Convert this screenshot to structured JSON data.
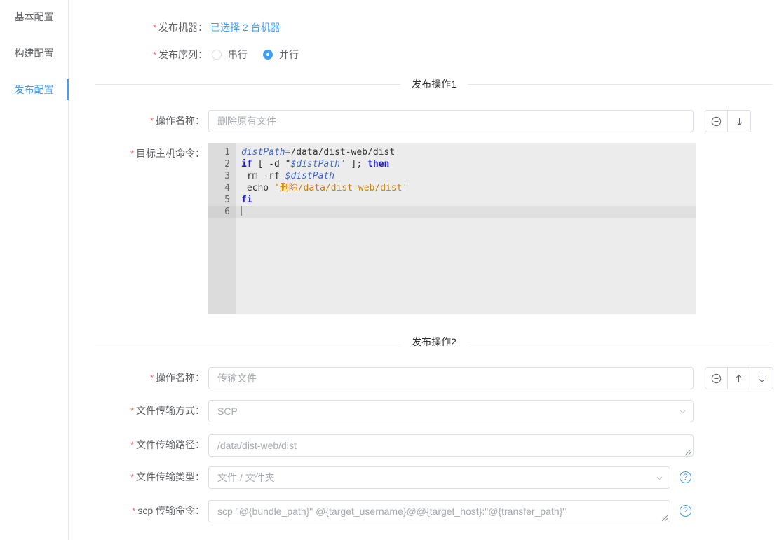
{
  "sidebar": {
    "items": [
      {
        "label": "基本配置",
        "active": false
      },
      {
        "label": "构建配置",
        "active": false
      },
      {
        "label": "发布配置",
        "active": true
      }
    ]
  },
  "form": {
    "machines": {
      "label": "发布机器",
      "required": true,
      "link_text": "已选择 2 台机器",
      "link_color": "#409eff"
    },
    "sequence": {
      "label": "发布序列",
      "required": true,
      "options": [
        {
          "label": "串行",
          "checked": false
        },
        {
          "label": "并行",
          "checked": true
        }
      ]
    }
  },
  "operations": [
    {
      "divider_title": "发布操作1",
      "name_field": {
        "label": "操作名称",
        "required": true,
        "value": "删除原有文件",
        "placeholder": "删除原有文件"
      },
      "command_field": {
        "label": "目标主机命令",
        "required": true,
        "line_numbers": [
          "1",
          "2",
          "3",
          "4",
          "5",
          "6"
        ],
        "active_line": 6,
        "code_lines": [
          "distPath=/data/dist-web/dist",
          "if [ -d \"$distPath\" ]; then",
          " rm -rf $distPath",
          " echo '删除/data/dist-web/dist'",
          "fi",
          ""
        ]
      },
      "buttons": [
        {
          "icon": "minus-circle-icon",
          "name": "remove-operation-button"
        },
        {
          "icon": "arrow-down-icon",
          "name": "move-down-button"
        }
      ]
    },
    {
      "divider_title": "发布操作2",
      "name_field": {
        "label": "操作名称",
        "required": true,
        "value": "传输文件",
        "placeholder": "传输文件"
      },
      "transfer_mode": {
        "label": "文件传输方式",
        "required": true,
        "value": "SCP",
        "placeholder": "SCP"
      },
      "transfer_path": {
        "label": "文件传输路径",
        "required": true,
        "value": "/data/dist-web/dist",
        "placeholder": "/data/dist-web/dist"
      },
      "transfer_type": {
        "label": "文件传输类型",
        "required": true,
        "value": "文件 / 文件夹",
        "placeholder": "文件 / 文件夹",
        "help_icon": "question-circle-icon"
      },
      "scp_command": {
        "label": "scp 传输命令",
        "required": true,
        "value": "scp \"@{bundle_path}\" @{target_username}@@{target_host}:\"@{transfer_path}\"",
        "placeholder": "scp \"@{bundle_path}\" @{target_username}@@{target_host}:\"@{transfer_path}\"",
        "help_icon": "question-circle-icon"
      },
      "buttons": [
        {
          "icon": "minus-circle-icon",
          "name": "remove-operation-button"
        },
        {
          "icon": "arrow-up-icon",
          "name": "move-up-button"
        },
        {
          "icon": "arrow-down-icon",
          "name": "move-down-button"
        }
      ]
    }
  ],
  "theme": {
    "accent": "#409eff",
    "required_star": "#f56c6c",
    "border": "#dcdfe6",
    "editor_bg": "#ececec",
    "gutter_bg": "#dcdcdc",
    "code_keyword": "#1a1ae6",
    "code_variable": "#4169cd",
    "code_string": "#c8820a",
    "code_text": "#333333"
  }
}
